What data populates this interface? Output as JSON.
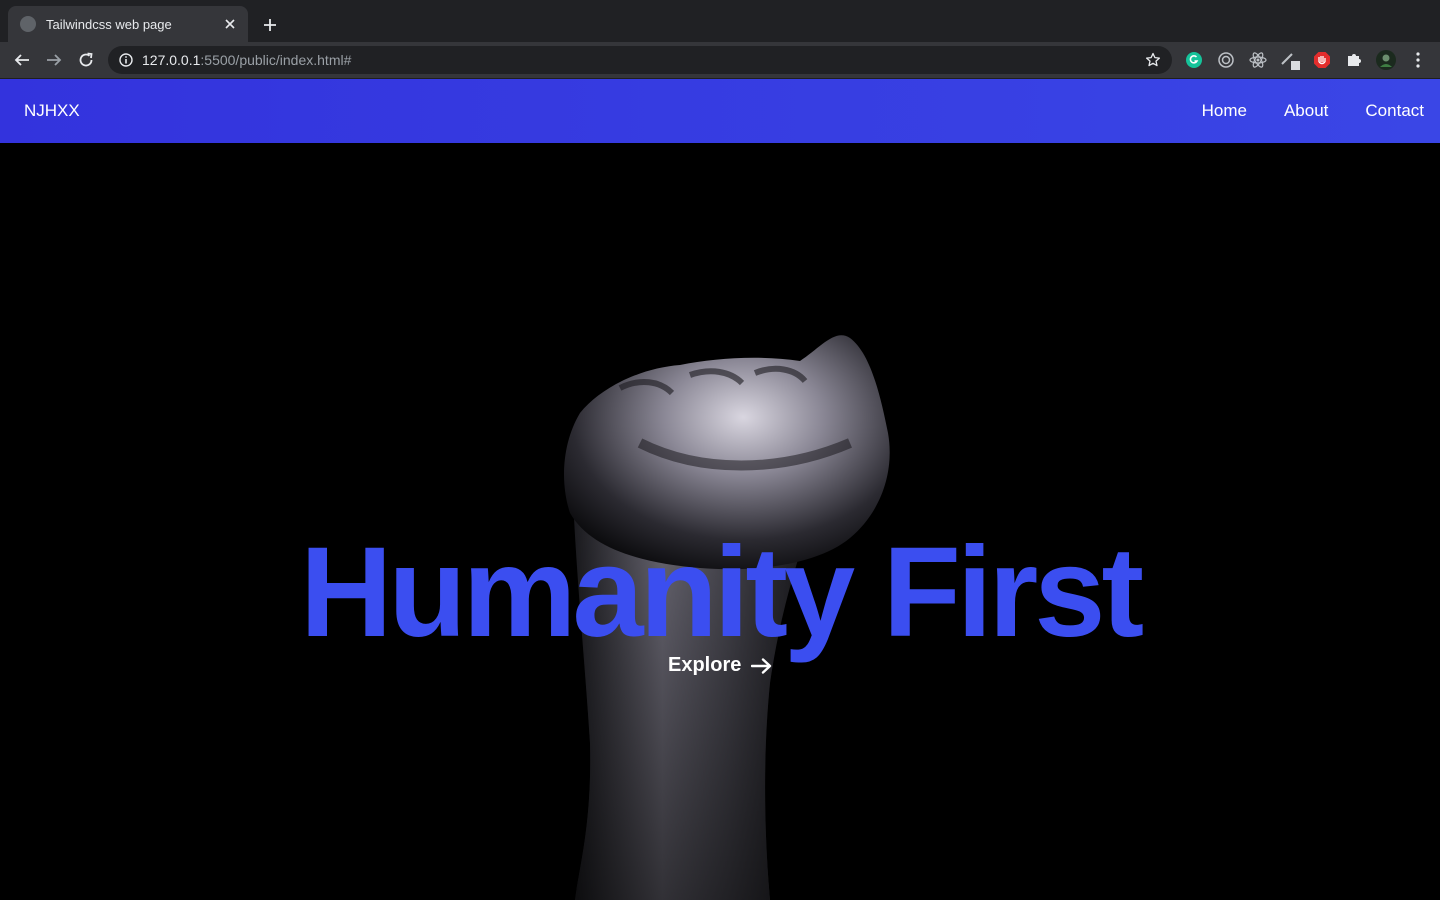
{
  "browser": {
    "tab_title": "Tailwindcss web page",
    "url_host": "127.0.0.1",
    "url_path": ":5500/public/index.html#",
    "extensions": [
      "grammarly-icon",
      "target-icon",
      "react-icon",
      "pen-icon",
      "adblock-icon",
      "puzzle-icon",
      "avatar"
    ]
  },
  "navbar": {
    "brand": "NJHXX",
    "links": [
      "Home",
      "About",
      "Contact"
    ],
    "bg_color": "#3a3fe2"
  },
  "hero": {
    "title": "Humanity First",
    "title_color": "#3b4ef0",
    "cta": "Explore",
    "image": "raised-fist-image"
  }
}
